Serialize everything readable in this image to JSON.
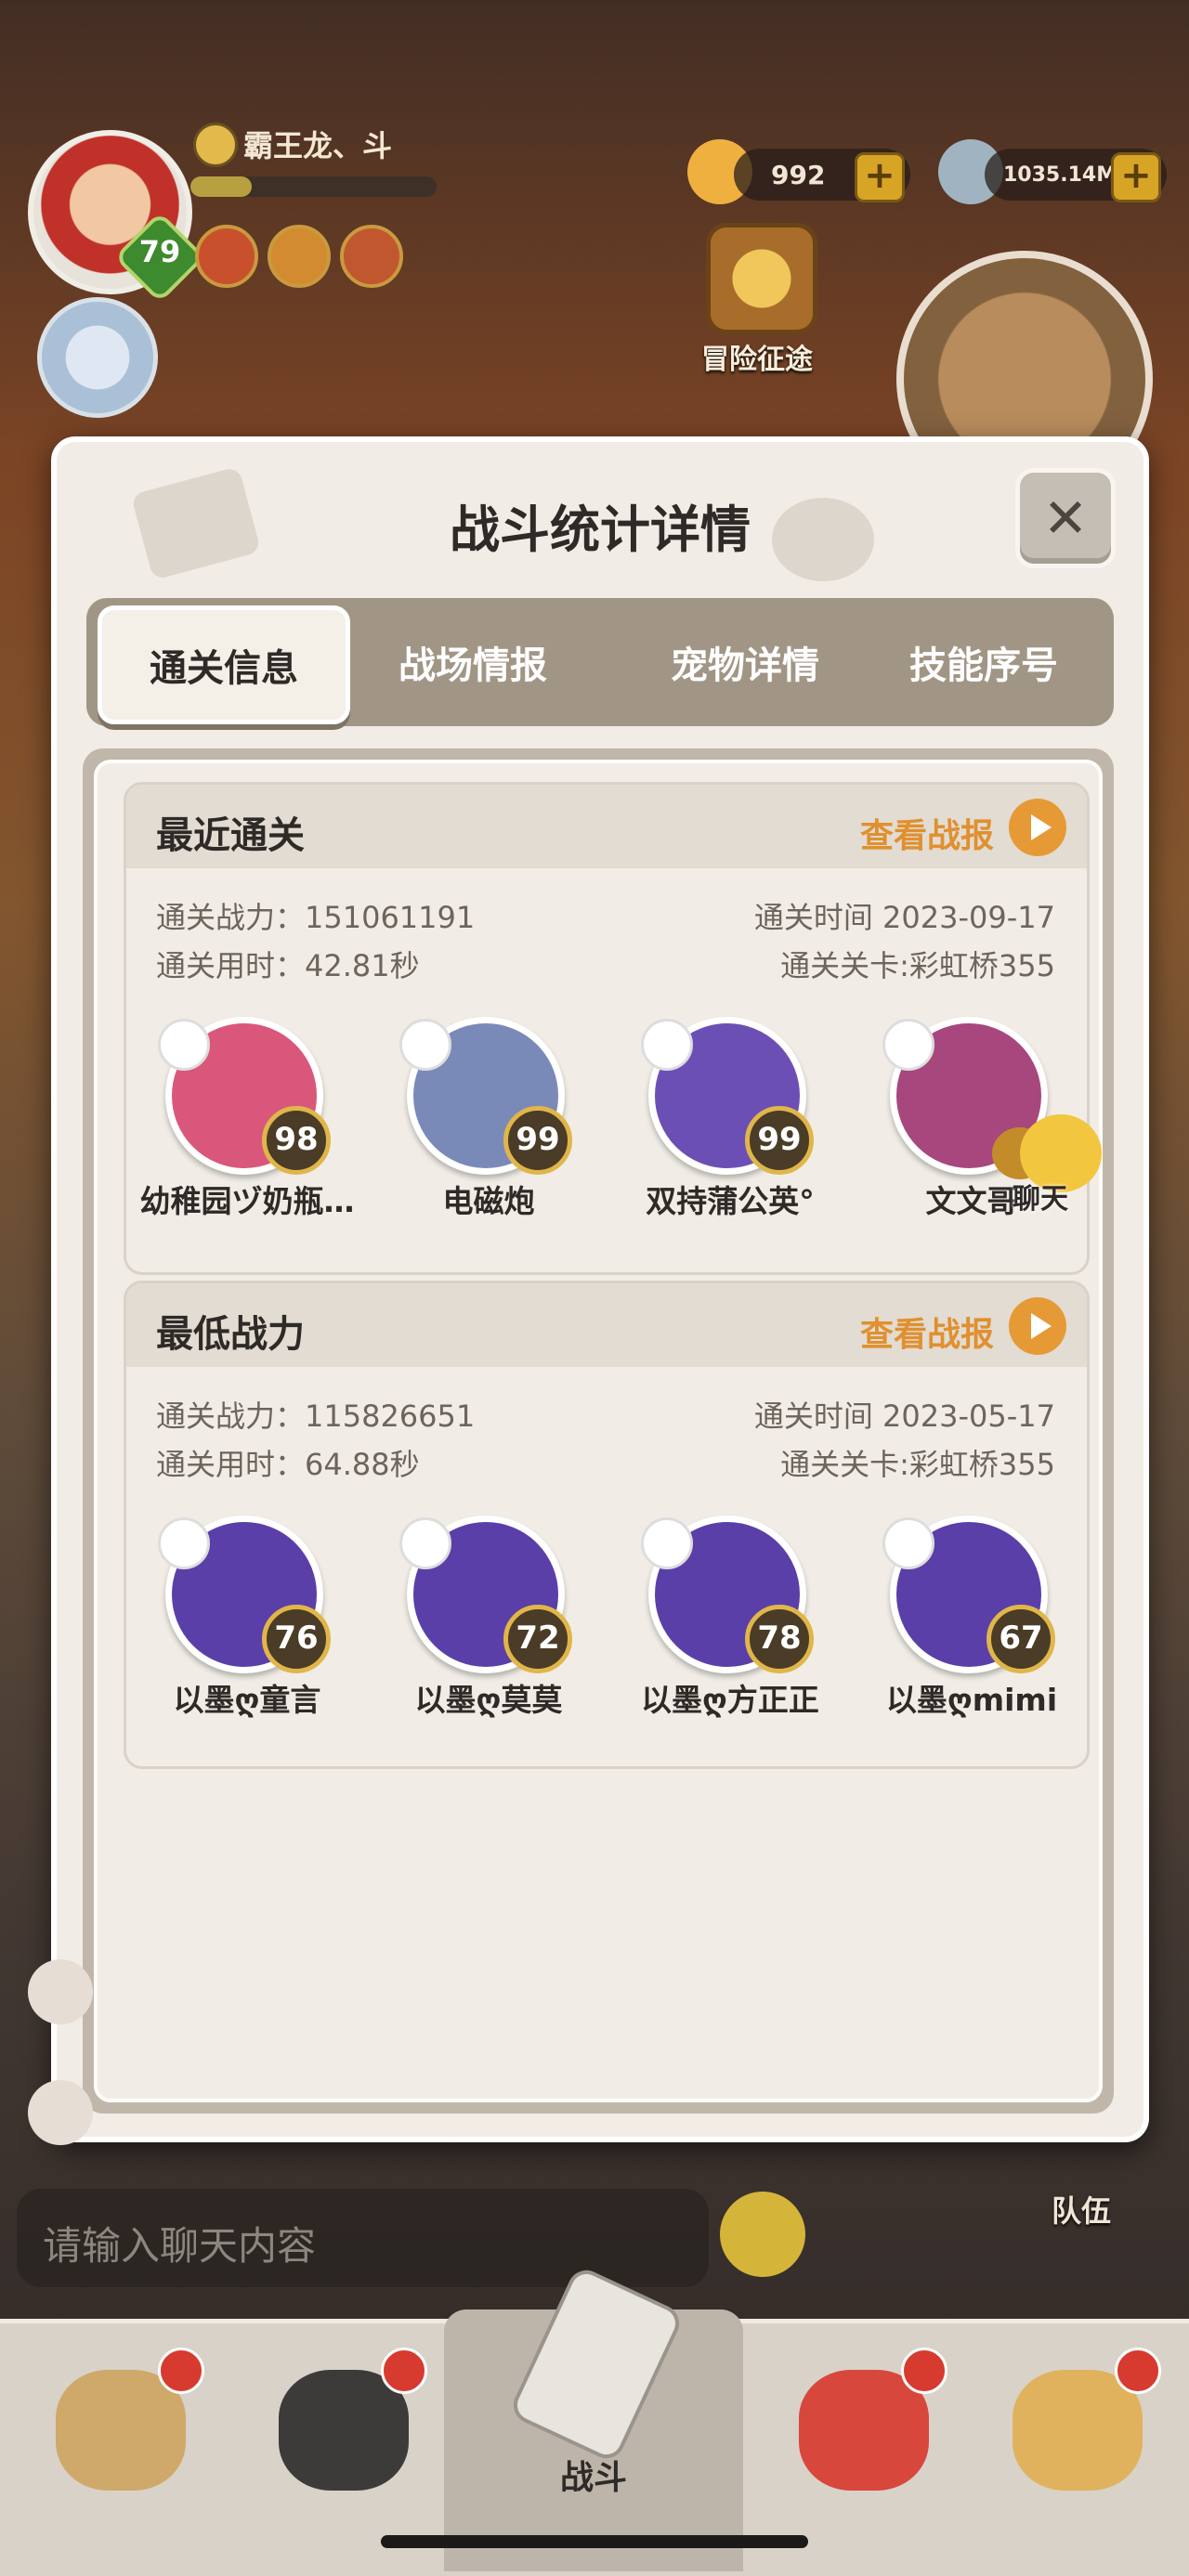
{
  "hud": {
    "player_name": "霸王龙、斗",
    "level": "79",
    "exp_progress": 0.25,
    "coins": "992",
    "gems": "1035.14M",
    "adventure_label": "冒险征途"
  },
  "modal": {
    "title": "战斗统计详情",
    "tabs": [
      "通关信息",
      "战场情报",
      "宠物详情",
      "技能序号"
    ],
    "active_tab": 0
  },
  "sections": [
    {
      "title": "最近通关",
      "report_link": "查看战报",
      "power": "通关战力：151061191",
      "time_used": "通关用时：42.81秒",
      "date": "通关时间  2023-09-17",
      "stage": "通关关卡:彩虹桥355",
      "pets": [
        {
          "name": "幼稚园ヅ奶瓶…",
          "level": "98",
          "color": "#d9577b"
        },
        {
          "name": "电磁炮",
          "level": "99",
          "color": "#7a8ab8"
        },
        {
          "name": "双持蒲公英°",
          "level": "99",
          "color": "#6c4fb5"
        },
        {
          "name": "文文哥",
          "level": "",
          "color": "#a7477e"
        }
      ]
    },
    {
      "title": "最低战力",
      "report_link": "查看战报",
      "power": "通关战力：115826651",
      "time_used": "通关用时：64.88秒",
      "date": "通关时间  2023-05-17",
      "stage": "通关关卡:彩虹桥355",
      "pets": [
        {
          "name": "以墨ღ童言",
          "level": "76",
          "color": "#5a3fa8"
        },
        {
          "name": "以墨ღ莫莫",
          "level": "72",
          "color": "#5a3fa8"
        },
        {
          "name": "以墨ღ方正正",
          "level": "78",
          "color": "#5a3fa8"
        },
        {
          "name": "以墨ღmimi",
          "level": "67",
          "color": "#5a3fa8"
        }
      ]
    }
  ],
  "chat": {
    "bubble_label": "聊天",
    "input_placeholder": "请输入聊天内容"
  },
  "team_label": "队伍",
  "nav": {
    "center_label": "战斗"
  },
  "colors": {
    "accent": "#e0902f",
    "tab_bar": "#a19686",
    "modal_bg": "#f1ece5"
  }
}
